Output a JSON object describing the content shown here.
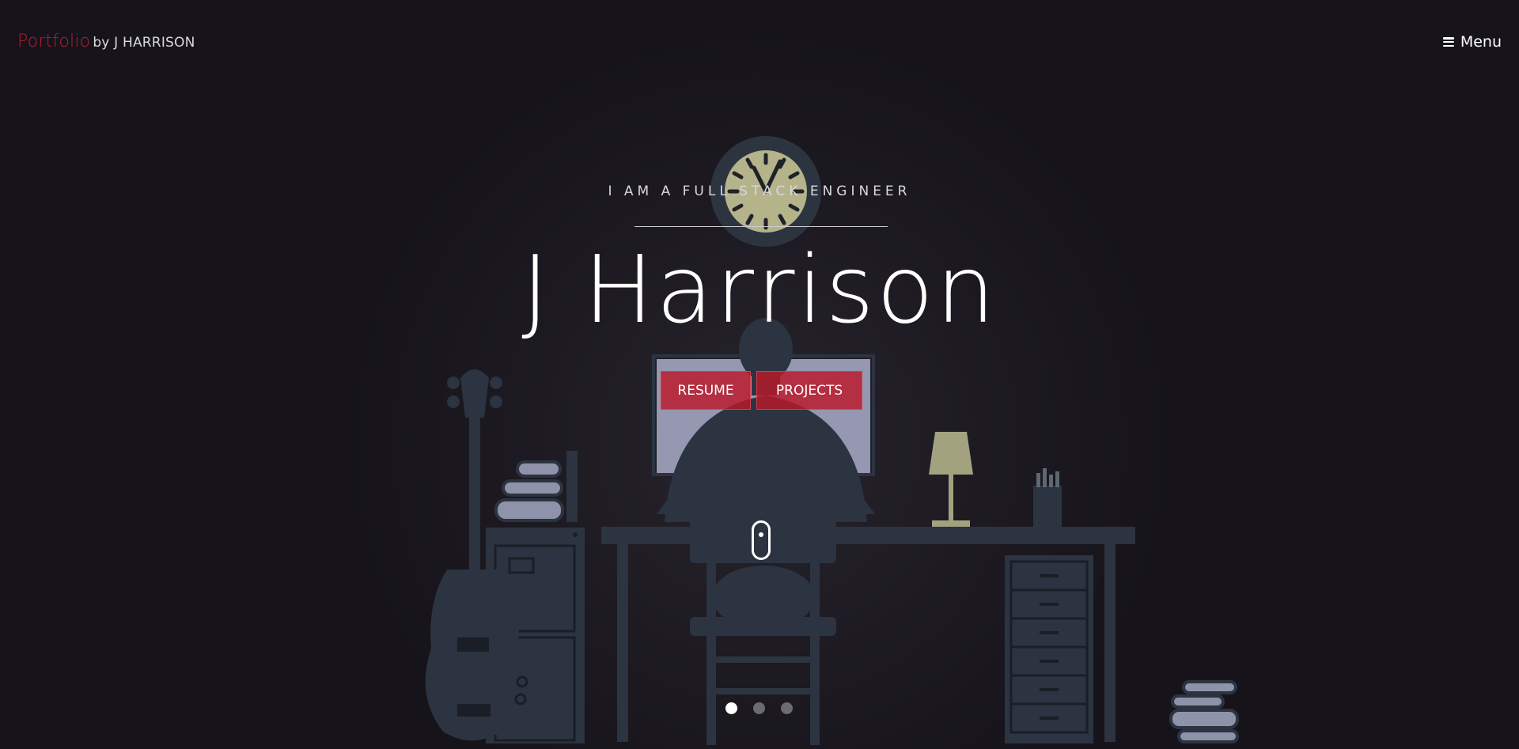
{
  "header": {
    "brand_accent": "Portfolio",
    "brand_rest": "by J HARRISON",
    "menu_label": "Menu",
    "menu_icon": "hamburger-icon"
  },
  "hero": {
    "subtitle": "I AM A FULL STACK ENGINEER",
    "name": "J Harrison",
    "buttons": {
      "resume": "RESUME",
      "projects": "PROJECTS"
    },
    "scroll_icon": "mouse-scroll-icon"
  },
  "carousel": {
    "slide_count": 3,
    "active_index": 0
  },
  "colors": {
    "background": "#16131b",
    "accent": "#b5202c",
    "button_fill": "#b91928",
    "illustration": "#2b3440",
    "clock_face": "#b4b38a",
    "lamp": "#a2a27e",
    "monitor": "#9697b0",
    "books": "#8e93aa"
  }
}
